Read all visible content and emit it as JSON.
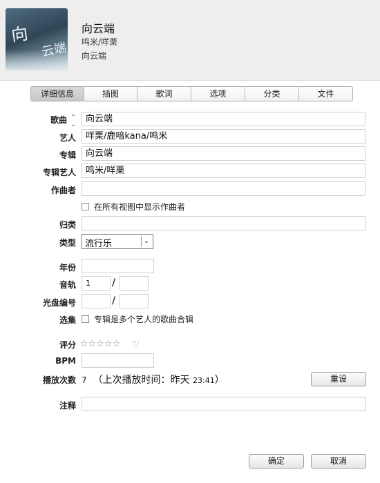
{
  "header": {
    "album_art_text": "向云端",
    "title": "向云端",
    "artist": "鸣米/咩栗",
    "album": "向云端"
  },
  "tabs": [
    "详细信息",
    "插图",
    "歌词",
    "选项",
    "分类",
    "文件"
  ],
  "active_tab": "详细信息",
  "fields": {
    "song": {
      "label": "歌曲",
      "value": "向云端"
    },
    "artist": {
      "label": "艺人",
      "value": "咩栗/鹿喑kana/鸣米"
    },
    "album": {
      "label": "专辑",
      "value": "向云端"
    },
    "album_artist": {
      "label": "专辑艺人",
      "value": "鸣米/咩栗"
    },
    "composer": {
      "label": "作曲者",
      "value": ""
    },
    "show_composer_checkbox": "在所有视图中显示作曲者",
    "grouping": {
      "label": "归类",
      "value": ""
    },
    "genre": {
      "label": "类型",
      "value": "流行乐"
    },
    "year": {
      "label": "年份",
      "value": ""
    },
    "track": {
      "label": "音轨",
      "number": "1",
      "total": ""
    },
    "disc": {
      "label": "光盘编号",
      "number": "",
      "total": ""
    },
    "compilation": {
      "label": "选集",
      "checkbox_label": "专辑是多个艺人的歌曲合辑"
    },
    "rating": {
      "label": "评分",
      "stars": "☆☆☆☆☆",
      "heart": "♡"
    },
    "bpm": {
      "label": "BPM",
      "value": ""
    },
    "play_count": {
      "label": "播放次数",
      "count": "7",
      "last_played": "（上次播放时间：昨天 ",
      "time": "23:41",
      "close": "）"
    },
    "comments": {
      "label": "注释",
      "value": ""
    }
  },
  "slash": "/",
  "buttons": {
    "reset": "重设",
    "ok": "确定",
    "cancel": "取消"
  }
}
